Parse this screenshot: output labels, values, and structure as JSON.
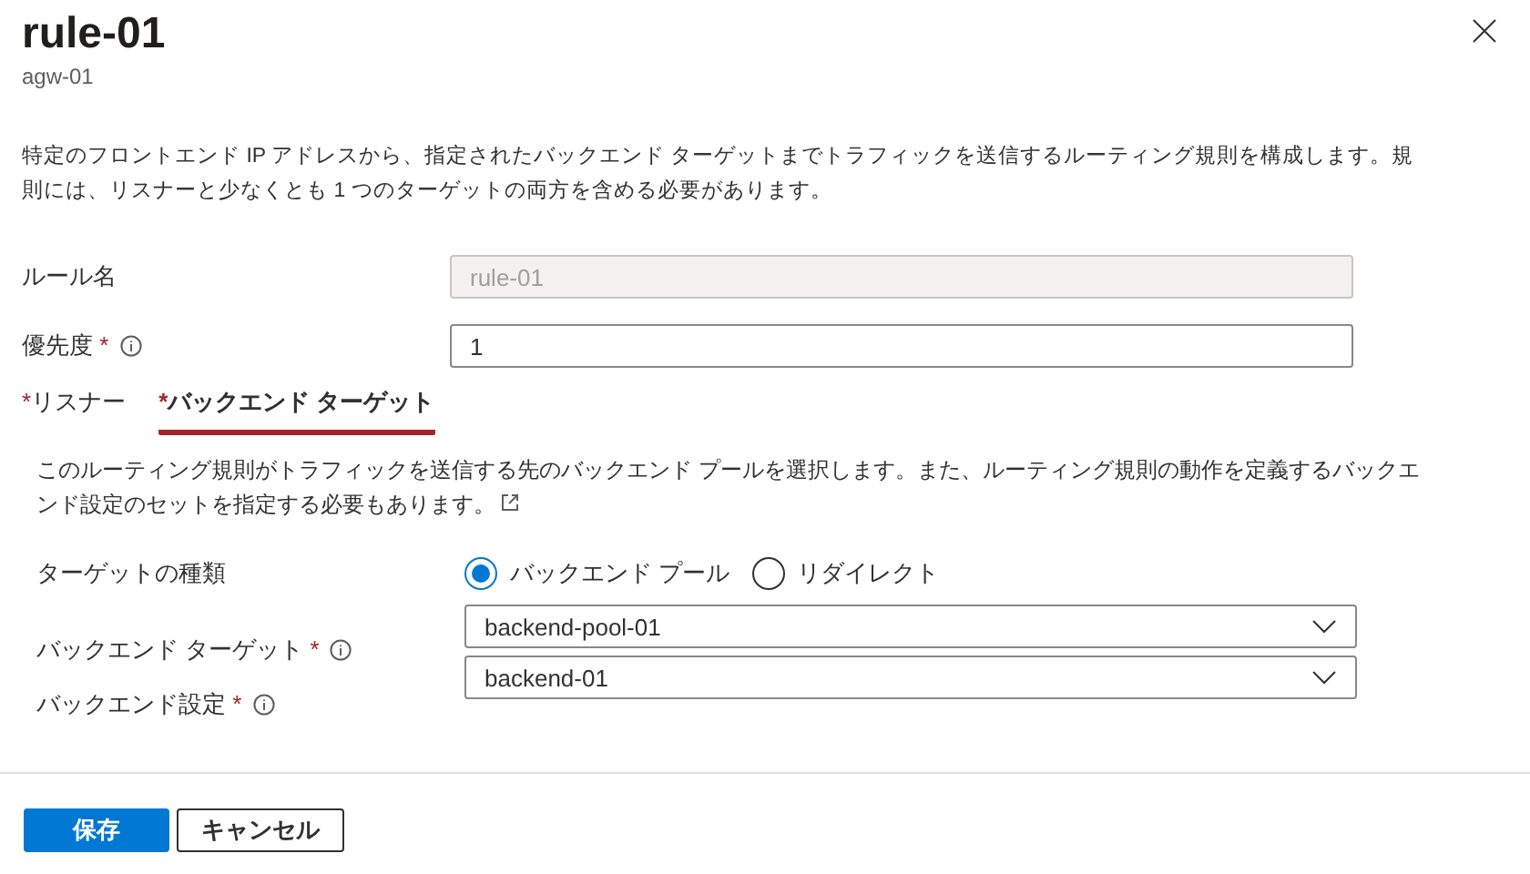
{
  "panel": {
    "title": "rule-01",
    "subtitle": "agw-01"
  },
  "description": "特定のフロントエンド IP アドレスから、指定されたバックエンド ターゲットまでトラフィックを送信するルーティング規則を構成します。規則には、リスナーと少なくとも 1 つのターゲットの両方を含める必要があります。",
  "fields": [
    {
      "label": "ルール名",
      "info": false,
      "value": "rule-01",
      "disabled": true
    },
    {
      "label": "優先度",
      "mark": "*",
      "info": true,
      "value": "1",
      "disabled": false
    }
  ],
  "tabs": [
    {
      "mark": "*",
      "label": "リスナー",
      "selected": false
    },
    {
      "mark": "*",
      "label": "バックエンド ターゲット",
      "selected": true
    }
  ],
  "section": {
    "description": "このルーティング規則がトラフィックを送信する先のバックエンド プールを選択します。また、ルーティング規則の動作を定義するバックエンド設定のセットを指定する必要もあります。",
    "target_type": {
      "label": "ターゲットの種類",
      "options": [
        {
          "label": "バックエンド プール",
          "selected": true
        },
        {
          "label": "リダイレクト",
          "selected": false
        }
      ]
    },
    "selects": [
      {
        "label": "バックエンド ターゲット",
        "mark": "*",
        "value": "backend-pool-01"
      },
      {
        "label": "バックエンド設定",
        "mark": "*",
        "value": "backend-01"
      }
    ]
  },
  "buttons": [
    {
      "label": "保存",
      "kind": "primary"
    },
    {
      "label": "キャンセル",
      "kind": "secondary"
    }
  ]
}
